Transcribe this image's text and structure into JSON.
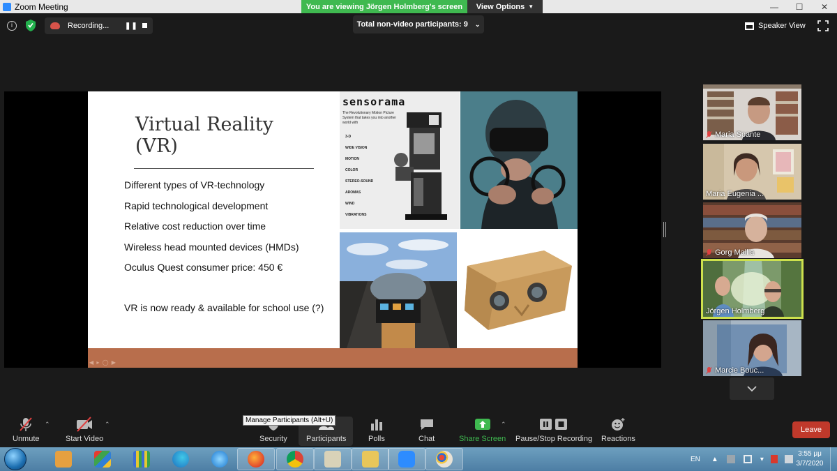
{
  "window": {
    "title": "Zoom Meeting"
  },
  "banner": {
    "viewing_text": "You are viewing Jörgen Holmberg's screen",
    "view_options": "View Options"
  },
  "topbar": {
    "recording_label": "Recording...",
    "participants_summary": "Total non-video participants: 9",
    "speaker_view": "Speaker View"
  },
  "slide": {
    "title": "Virtual Reality\n(VR)",
    "bullets": [
      "Different types of VR-technology",
      "Rapid technological development",
      "Relative cost reduction over time",
      "Wireless head mounted devices (HMDs)",
      "Oculus Quest consumer price: 450 €"
    ],
    "note": "VR is now ready & available for school use (?)",
    "sensorama": {
      "brand": "sensorama",
      "blurb": "The Revolutionary Motion Picture System that takes you into another world with",
      "features": [
        "3-D",
        "WIDE VISION",
        "MOTION",
        "COLOR",
        "STEREO-SOUND",
        "AROMAS",
        "WIND",
        "VIBRATIONS"
      ]
    }
  },
  "participants": [
    {
      "name": "Maria Spante",
      "muted": true
    },
    {
      "name": "Maria Eugenia ...",
      "muted": false
    },
    {
      "name": "Gorg Mallia",
      "muted": true
    },
    {
      "name": "Jörgen Holmberg",
      "muted": false,
      "active_speaker": true
    },
    {
      "name": "Marcie Bouc...",
      "muted": true
    }
  ],
  "toolbar": {
    "unmute": "Unmute",
    "start_video": "Start Video",
    "security": "Security",
    "participants": "Participants",
    "polls": "Polls",
    "chat": "Chat",
    "share_screen": "Share Screen",
    "pause_stop_recording": "Pause/Stop Recording",
    "reactions": "Reactions",
    "leave": "Leave",
    "tooltip": "Manage Participants (Alt+U)"
  },
  "taskbar": {
    "language": "EN",
    "time": "3:55 μμ",
    "date": "3/7/2020"
  },
  "colors": {
    "share_green": "#3fb950",
    "leave_red": "#c0392b",
    "active_speaker_border": "#cde14d",
    "slide_footer": "#b86e4c"
  }
}
